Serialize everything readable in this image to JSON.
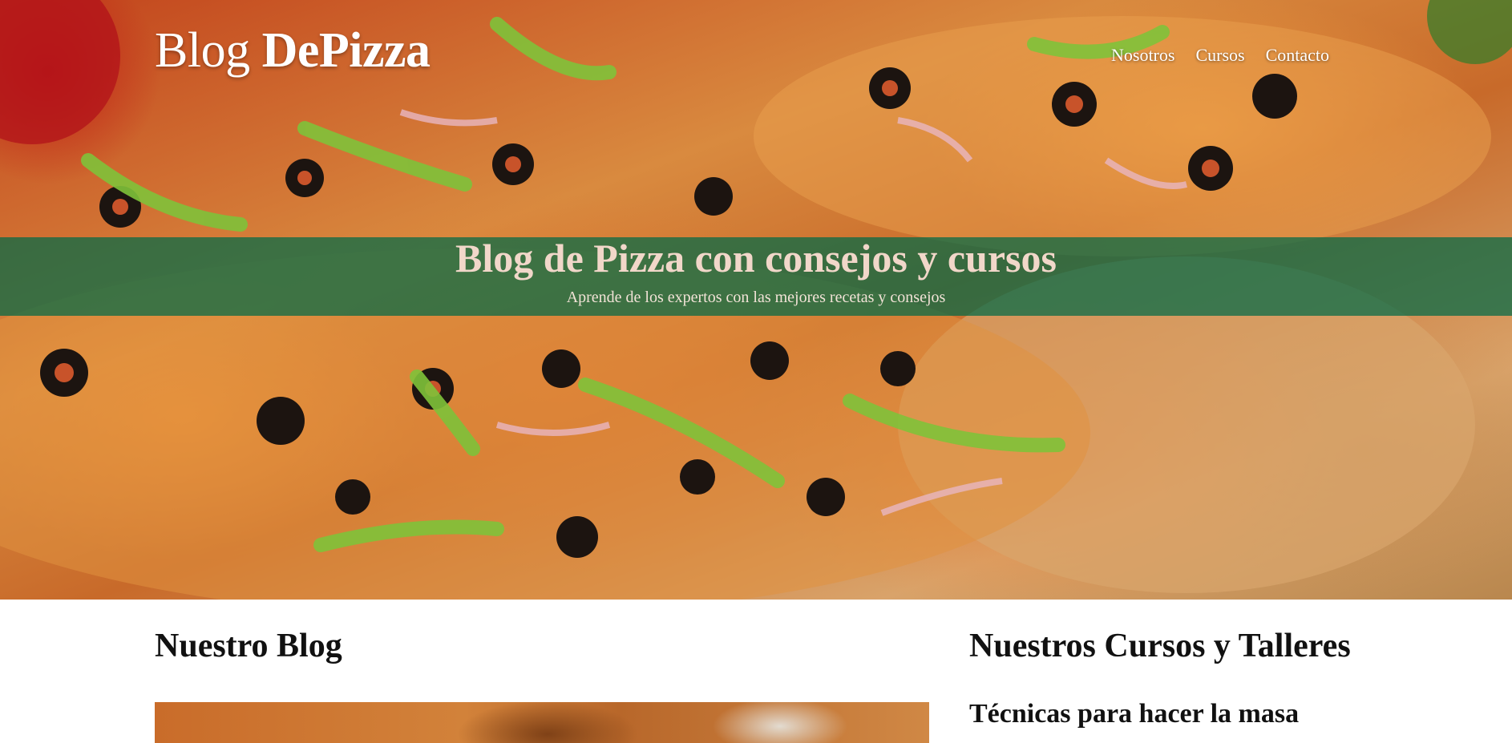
{
  "header": {
    "brand_light": "Blog ",
    "brand_bold": "DePizza",
    "nav": [
      {
        "label": "Nosotros"
      },
      {
        "label": "Cursos"
      },
      {
        "label": "Contacto"
      }
    ]
  },
  "hero": {
    "title": "Blog de Pizza con consejos y cursos",
    "subtitle": "Aprende de los expertos con las mejores recetas y consejos"
  },
  "blog": {
    "heading": "Nuestro Blog"
  },
  "courses": {
    "heading": "Nuestros Cursos y Talleres",
    "items": [
      {
        "title": "Técnicas para hacer la masa"
      }
    ]
  },
  "colors": {
    "banner": "#006946",
    "banner_title": "#f1d7c9",
    "heading_text": "#111111"
  }
}
